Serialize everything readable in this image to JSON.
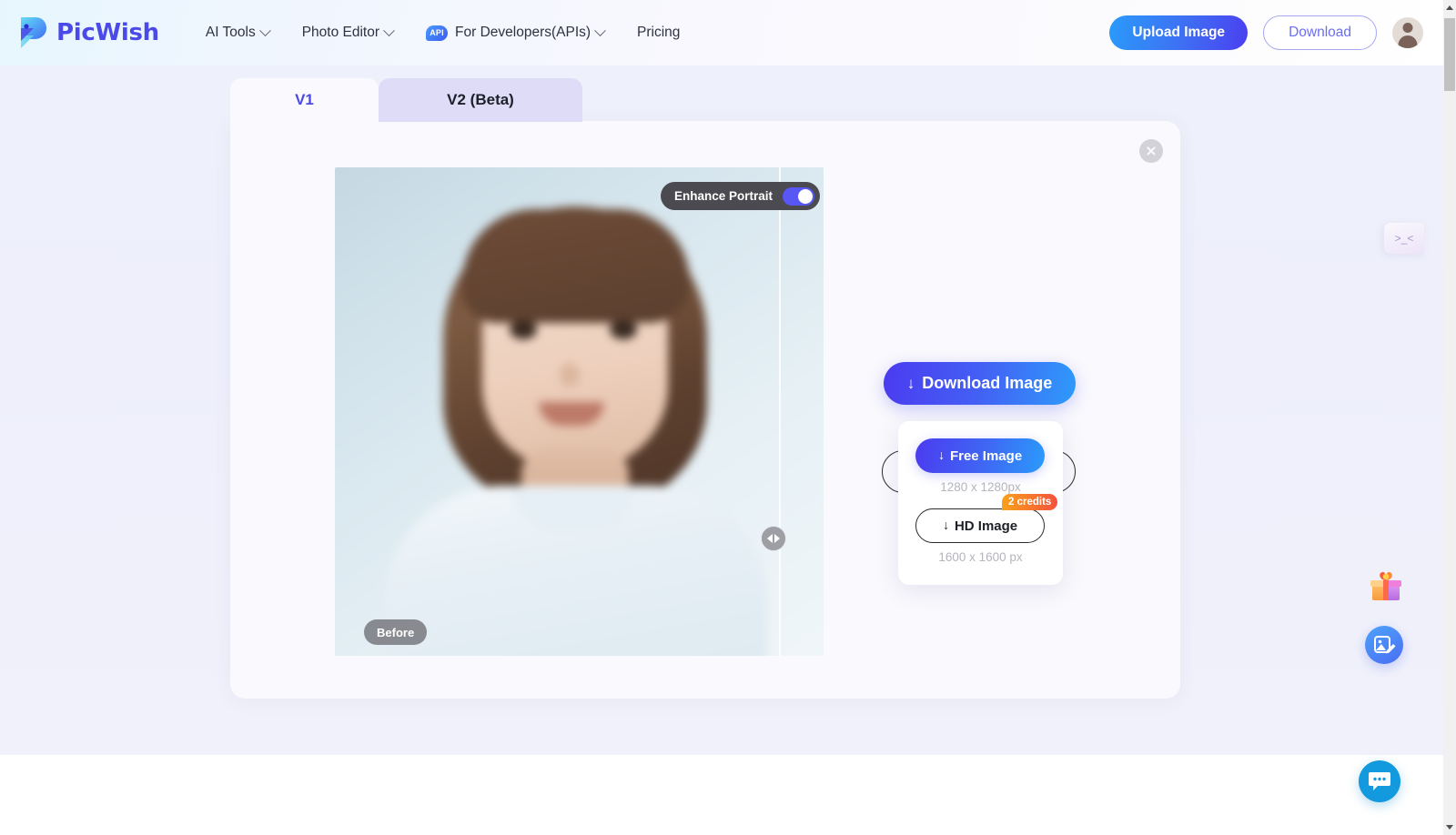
{
  "header": {
    "brand": "PicWish",
    "logo_icon": "picwish-bird-logo",
    "nav": [
      {
        "label": "AI Tools",
        "has_chevron": true,
        "icon": null
      },
      {
        "label": "Photo Editor",
        "has_chevron": true,
        "icon": null
      },
      {
        "label": "For Developers(APIs)",
        "has_chevron": true,
        "icon": "api-cloud-badge",
        "badge_text": "API"
      },
      {
        "label": "Pricing",
        "has_chevron": false,
        "icon": null
      }
    ],
    "upload_label": "Upload Image",
    "download_label": "Download",
    "avatar_icon": "user-avatar"
  },
  "tabs": [
    {
      "label": "V1",
      "active": true
    },
    {
      "label": "V2 (Beta)",
      "active": false
    }
  ],
  "editor": {
    "close_icon": "close-icon",
    "enhance_toggle": {
      "label": "Enhance Portrait",
      "state": "on"
    },
    "before_label": "Before",
    "slider_handle_icon": "left-right-arrows-icon",
    "image_description": "blurred portrait photo of a young girl with brown bob hair in a white top"
  },
  "download": {
    "main_button": {
      "label": "Download Image",
      "icon": "download-arrow-icon"
    },
    "options": [
      {
        "label": "Free Image",
        "icon": "download-arrow-icon",
        "size": "1280 x 1280px",
        "credits": null,
        "style": "primary"
      },
      {
        "label": "HD Image",
        "icon": "download-arrow-icon",
        "size": "1600 x 1600 px",
        "credits": "2 credits",
        "style": "outline"
      }
    ]
  },
  "floating": {
    "feedback_widget_icon": "kaomoji-face-widget",
    "feedback_widget_text": ">_<",
    "gift_icon": "gift-box-icon",
    "photo_edit_icon": "photo-edit-icon",
    "chat_icon": "chat-bubble-icon"
  },
  "colors": {
    "accent_purple": "#4b49e8",
    "accent_blue": "#2a9bfa",
    "toggle_on": "#5856f5",
    "credits_badge": "#f5513d",
    "chat_blue": "#1399dd"
  }
}
